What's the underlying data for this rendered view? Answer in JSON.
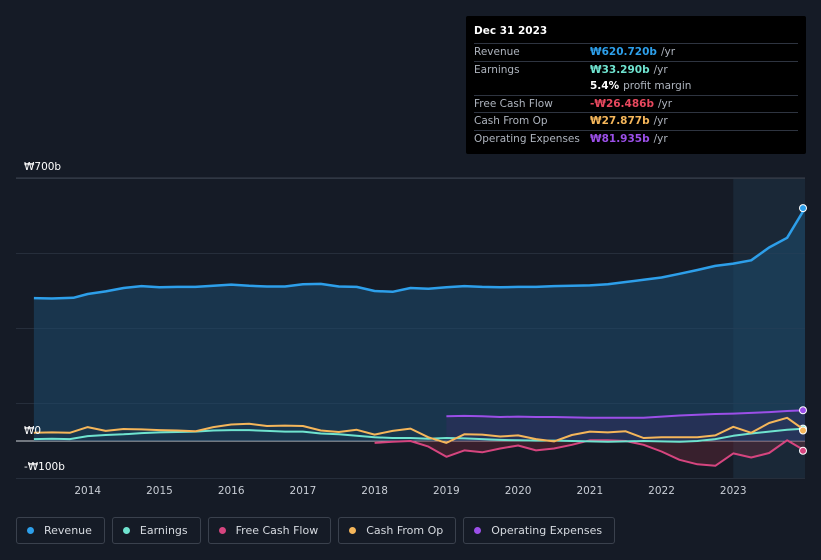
{
  "tooltip": {
    "date": "Dec 31 2023",
    "rows": [
      {
        "label": "Revenue",
        "value": "₩620.720b",
        "unit": "/yr",
        "color": "#2d9fea"
      },
      {
        "label": "Earnings",
        "value": "₩33.290b",
        "unit": "/yr",
        "color": "#6fe3cf"
      },
      {
        "label": "",
        "value": "5.4%",
        "unit": "profit margin",
        "color": "#ffffff"
      },
      {
        "label": "Free Cash Flow",
        "value": "-₩26.486b",
        "unit": "/yr",
        "color": "#e8485e"
      },
      {
        "label": "Cash From Op",
        "value": "₩27.877b",
        "unit": "/yr",
        "color": "#f5b65a"
      },
      {
        "label": "Operating Expenses",
        "value": "₩81.935b",
        "unit": "/yr",
        "color": "#9b4fe8"
      }
    ]
  },
  "legend": [
    {
      "label": "Revenue",
      "color": "#2d9fea"
    },
    {
      "label": "Earnings",
      "color": "#6fe3cf"
    },
    {
      "label": "Free Cash Flow",
      "color": "#d6457f"
    },
    {
      "label": "Cash From Op",
      "color": "#f5b65a"
    },
    {
      "label": "Operating Expenses",
      "color": "#9b4fe8"
    }
  ],
  "chart_data": {
    "type": "area",
    "y_tick_labels": [
      "₩700b",
      "₩0",
      "-₩100b"
    ],
    "x_tick_labels": [
      "2014",
      "2015",
      "2016",
      "2017",
      "2018",
      "2019",
      "2020",
      "2021",
      "2022",
      "2023"
    ],
    "ylim": [
      -100,
      700
    ],
    "xlim": [
      2013.0,
      2024.0
    ],
    "grid": true,
    "highlight_from": 2023.0,
    "series": [
      {
        "name": "Revenue",
        "color": "#2d9fea",
        "fill": true,
        "points": [
          [
            2013.25,
            381
          ],
          [
            2013.5,
            380
          ],
          [
            2013.8,
            382
          ],
          [
            2014.0,
            392
          ],
          [
            2014.25,
            399
          ],
          [
            2014.5,
            408
          ],
          [
            2014.75,
            413
          ],
          [
            2015.0,
            410
          ],
          [
            2015.25,
            411
          ],
          [
            2015.5,
            411
          ],
          [
            2015.75,
            414
          ],
          [
            2016.0,
            417
          ],
          [
            2016.25,
            414
          ],
          [
            2016.5,
            412
          ],
          [
            2016.75,
            412
          ],
          [
            2017.0,
            418
          ],
          [
            2017.25,
            419
          ],
          [
            2017.5,
            412
          ],
          [
            2017.75,
            411
          ],
          [
            2018.0,
            400
          ],
          [
            2018.25,
            398
          ],
          [
            2018.5,
            408
          ],
          [
            2018.75,
            406
          ],
          [
            2019.0,
            410
          ],
          [
            2019.25,
            413
          ],
          [
            2019.5,
            411
          ],
          [
            2019.75,
            410
          ],
          [
            2020.0,
            411
          ],
          [
            2020.25,
            411
          ],
          [
            2020.5,
            413
          ],
          [
            2020.75,
            414
          ],
          [
            2021.0,
            415
          ],
          [
            2021.25,
            418
          ],
          [
            2021.5,
            424
          ],
          [
            2021.75,
            430
          ],
          [
            2022.0,
            436
          ],
          [
            2022.25,
            446
          ],
          [
            2022.5,
            456
          ],
          [
            2022.75,
            467
          ],
          [
            2023.0,
            473
          ],
          [
            2023.25,
            482
          ],
          [
            2023.5,
            516
          ],
          [
            2023.75,
            542
          ],
          [
            2024.0,
            621
          ]
        ]
      },
      {
        "name": "Earnings",
        "color": "#6fe3cf",
        "fill": false,
        "points": [
          [
            2013.25,
            5
          ],
          [
            2013.5,
            6
          ],
          [
            2013.75,
            5
          ],
          [
            2014.0,
            13
          ],
          [
            2014.25,
            16
          ],
          [
            2014.5,
            18
          ],
          [
            2014.75,
            21
          ],
          [
            2015.0,
            23
          ],
          [
            2015.25,
            24
          ],
          [
            2015.5,
            25
          ],
          [
            2015.75,
            28
          ],
          [
            2016.0,
            29
          ],
          [
            2016.25,
            29
          ],
          [
            2016.5,
            27
          ],
          [
            2016.75,
            25
          ],
          [
            2017.0,
            25
          ],
          [
            2017.25,
            20
          ],
          [
            2017.5,
            18
          ],
          [
            2017.75,
            14
          ],
          [
            2018.0,
            10
          ],
          [
            2018.25,
            8
          ],
          [
            2018.5,
            8
          ],
          [
            2018.75,
            6
          ],
          [
            2019.0,
            8
          ],
          [
            2019.25,
            7
          ],
          [
            2019.5,
            5
          ],
          [
            2019.75,
            3
          ],
          [
            2020.0,
            2
          ],
          [
            2020.25,
            1
          ],
          [
            2020.5,
            1
          ],
          [
            2020.75,
            0
          ],
          [
            2021.0,
            -1
          ],
          [
            2021.25,
            -2
          ],
          [
            2021.5,
            -1
          ],
          [
            2021.75,
            0
          ],
          [
            2022.0,
            -1
          ],
          [
            2022.25,
            -2
          ],
          [
            2022.5,
            0
          ],
          [
            2022.75,
            5
          ],
          [
            2023.0,
            14
          ],
          [
            2023.25,
            20
          ],
          [
            2023.5,
            25
          ],
          [
            2023.75,
            30
          ],
          [
            2024.0,
            33
          ]
        ]
      },
      {
        "name": "Cash From Op",
        "color": "#f5b65a",
        "fill": false,
        "points": [
          [
            2013.25,
            22
          ],
          [
            2013.5,
            23
          ],
          [
            2013.75,
            22
          ],
          [
            2014.0,
            37
          ],
          [
            2014.25,
            27
          ],
          [
            2014.5,
            32
          ],
          [
            2014.75,
            31
          ],
          [
            2015.0,
            29
          ],
          [
            2015.25,
            28
          ],
          [
            2015.5,
            26
          ],
          [
            2015.75,
            37
          ],
          [
            2016.0,
            44
          ],
          [
            2016.25,
            46
          ],
          [
            2016.5,
            40
          ],
          [
            2016.75,
            41
          ],
          [
            2017.0,
            40
          ],
          [
            2017.25,
            28
          ],
          [
            2017.5,
            24
          ],
          [
            2017.75,
            30
          ],
          [
            2018.0,
            17
          ],
          [
            2018.25,
            27
          ],
          [
            2018.5,
            33
          ],
          [
            2018.75,
            10
          ],
          [
            2019.0,
            -5
          ],
          [
            2019.25,
            18
          ],
          [
            2019.5,
            17
          ],
          [
            2019.75,
            12
          ],
          [
            2020.0,
            15
          ],
          [
            2020.25,
            5
          ],
          [
            2020.5,
            -1
          ],
          [
            2020.75,
            16
          ],
          [
            2021.0,
            25
          ],
          [
            2021.25,
            23
          ],
          [
            2021.5,
            26
          ],
          [
            2021.75,
            8
          ],
          [
            2022.0,
            10
          ],
          [
            2022.25,
            10
          ],
          [
            2022.5,
            10
          ],
          [
            2022.75,
            15
          ],
          [
            2023.0,
            38
          ],
          [
            2023.25,
            22
          ],
          [
            2023.5,
            48
          ],
          [
            2023.75,
            62
          ],
          [
            2024.0,
            28
          ]
        ]
      },
      {
        "name": "Free Cash Flow",
        "color": "#d6457f",
        "fill": true,
        "points": [
          [
            2018.0,
            -5
          ],
          [
            2018.25,
            -2
          ],
          [
            2018.5,
            0
          ],
          [
            2018.75,
            -15
          ],
          [
            2019.0,
            -42
          ],
          [
            2019.25,
            -25
          ],
          [
            2019.5,
            -30
          ],
          [
            2019.75,
            -20
          ],
          [
            2020.0,
            -12
          ],
          [
            2020.25,
            -25
          ],
          [
            2020.5,
            -20
          ],
          [
            2020.75,
            -10
          ],
          [
            2021.0,
            2
          ],
          [
            2021.25,
            2
          ],
          [
            2021.5,
            0
          ],
          [
            2021.75,
            -10
          ],
          [
            2022.0,
            -28
          ],
          [
            2022.25,
            -50
          ],
          [
            2022.5,
            -62
          ],
          [
            2022.75,
            -66
          ],
          [
            2023.0,
            -33
          ],
          [
            2023.25,
            -44
          ],
          [
            2023.5,
            -32
          ],
          [
            2023.75,
            2
          ],
          [
            2024.0,
            -26
          ]
        ]
      },
      {
        "name": "Operating Expenses",
        "color": "#9b4fe8",
        "fill": true,
        "points": [
          [
            2019.0,
            66
          ],
          [
            2019.25,
            67
          ],
          [
            2019.5,
            66
          ],
          [
            2019.75,
            64
          ],
          [
            2020.0,
            65
          ],
          [
            2020.25,
            64
          ],
          [
            2020.5,
            64
          ],
          [
            2020.75,
            63
          ],
          [
            2021.0,
            62
          ],
          [
            2021.25,
            62
          ],
          [
            2021.5,
            62
          ],
          [
            2021.75,
            62
          ],
          [
            2022.0,
            65
          ],
          [
            2022.25,
            68
          ],
          [
            2022.5,
            70
          ],
          [
            2022.75,
            72
          ],
          [
            2023.0,
            73
          ],
          [
            2023.25,
            75
          ],
          [
            2023.5,
            77
          ],
          [
            2023.75,
            80
          ],
          [
            2024.0,
            82
          ]
        ]
      }
    ]
  }
}
